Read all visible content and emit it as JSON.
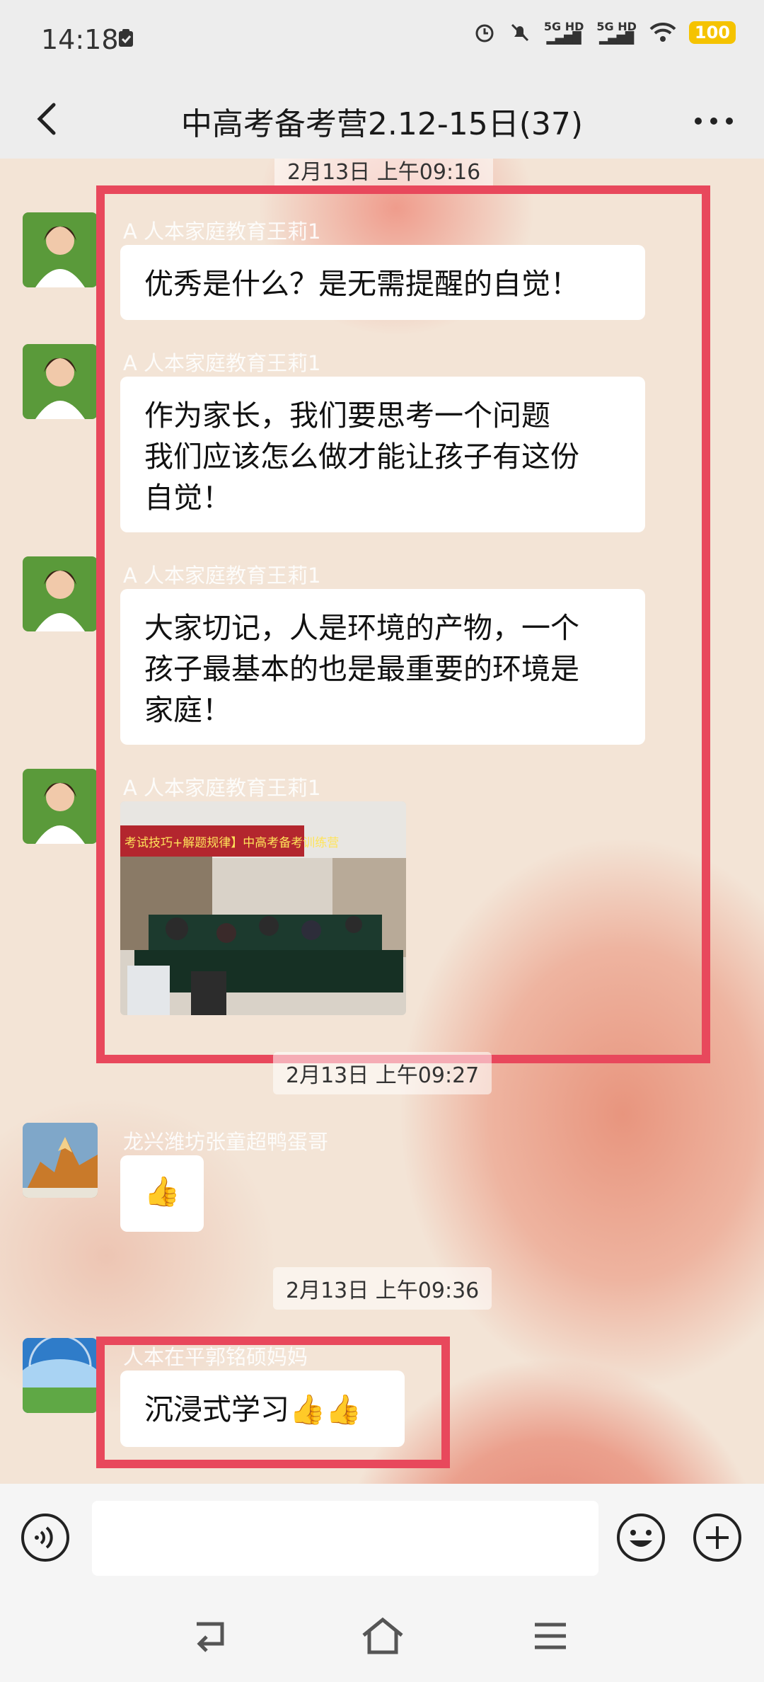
{
  "status_bar": {
    "time": "14:18",
    "network1": "5G HD",
    "network2": "5G HD",
    "battery": "100",
    "icons": [
      "clipboard-icon",
      "alarm-icon",
      "mute-icon",
      "signal-icon",
      "wifi-icon"
    ]
  },
  "header": {
    "title": "中高考备考营2.12-15日(37)",
    "back_icon": "back-arrow-icon",
    "more_icon": "more-dots-icon"
  },
  "chat": {
    "timestamps": [
      "2月13日 上午09:16",
      "2月13日 上午09:27",
      "2月13日 上午09:36"
    ],
    "messages": [
      {
        "sender": "A 人本家庭教育王莉1",
        "lines": [
          "优秀是什么？是无需提醒的自觉！"
        ]
      },
      {
        "sender": "A 人本家庭教育王莉1",
        "lines": [
          "作为家长，我们要思考一个问题",
          "我们应该怎么做才能让孩子有这份",
          "自觉！"
        ]
      },
      {
        "sender": "A 人本家庭教育王莉1",
        "lines": [
          "大家切记，人是环境的产物，一个",
          "孩子最基本的也是最重要的环境是",
          "家庭！"
        ]
      },
      {
        "sender": "A 人本家庭教育王莉1",
        "image_banner": "考试技巧+解题规律】中高考备考训练营"
      },
      {
        "sender": "龙兴潍坊张童超鸭蛋哥",
        "emoji": "👍"
      },
      {
        "sender": "人本在平郭铭硕妈妈",
        "lines": [
          "沉浸式学习👍👍"
        ]
      }
    ]
  },
  "input_bar": {
    "placeholder": "",
    "voice_icon": "voice-icon",
    "emoji_icon": "emoji-icon",
    "add_icon": "add-icon"
  },
  "system_nav": [
    "back-nav-icon",
    "home-nav-icon",
    "menu-nav-icon"
  ],
  "colors": {
    "highlight": "#e8485c",
    "bar_bg": "#ededed"
  }
}
